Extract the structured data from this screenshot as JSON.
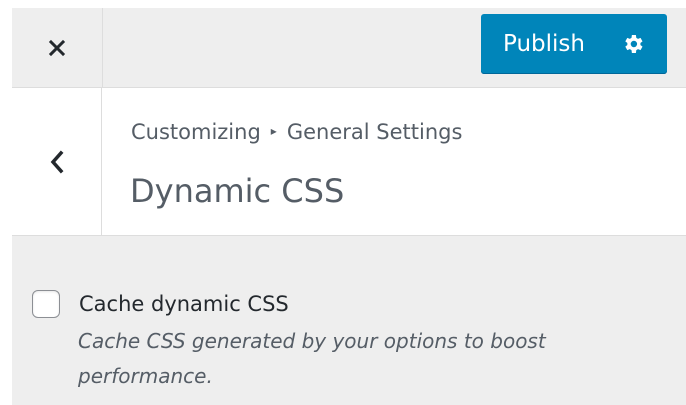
{
  "header": {
    "close_icon": "close-icon",
    "publish_label": "Publish",
    "publish_color": "#0085ba",
    "settings_icon": "gear-icon"
  },
  "section": {
    "back_icon": "chevron-left-icon",
    "breadcrumb": {
      "parent": "Customizing",
      "separator": "▸",
      "current": "General Settings"
    },
    "title": "Dynamic CSS"
  },
  "control": {
    "checked": false,
    "label": "Cache dynamic CSS",
    "description": "Cache CSS generated by your options to boost performance."
  }
}
